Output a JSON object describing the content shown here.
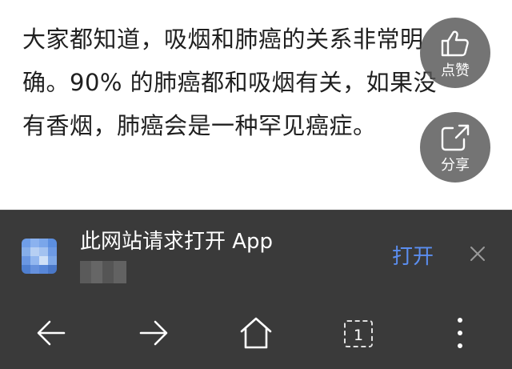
{
  "article": {
    "lines": [
      "大家都知道，吸烟和肺癌的关系非常明",
      "确。90% 的肺癌都和吸烟有关，如果没",
      "有香烟，肺癌会是一种罕见癌症。"
    ]
  },
  "float_actions": {
    "like_label": "点赞",
    "share_label": "分享"
  },
  "open_app_prompt": {
    "title": "此网站请求打开 App",
    "open_label": "打开",
    "accent_color": "#5b8ef0"
  },
  "bottom_nav": {
    "items": [
      "back-icon",
      "forward-icon",
      "home-icon",
      "tabs-icon",
      "more-icon"
    ],
    "tab_count": "1"
  },
  "colors": {
    "bar_background": "#3a3a3a",
    "float_button": "#555555"
  }
}
